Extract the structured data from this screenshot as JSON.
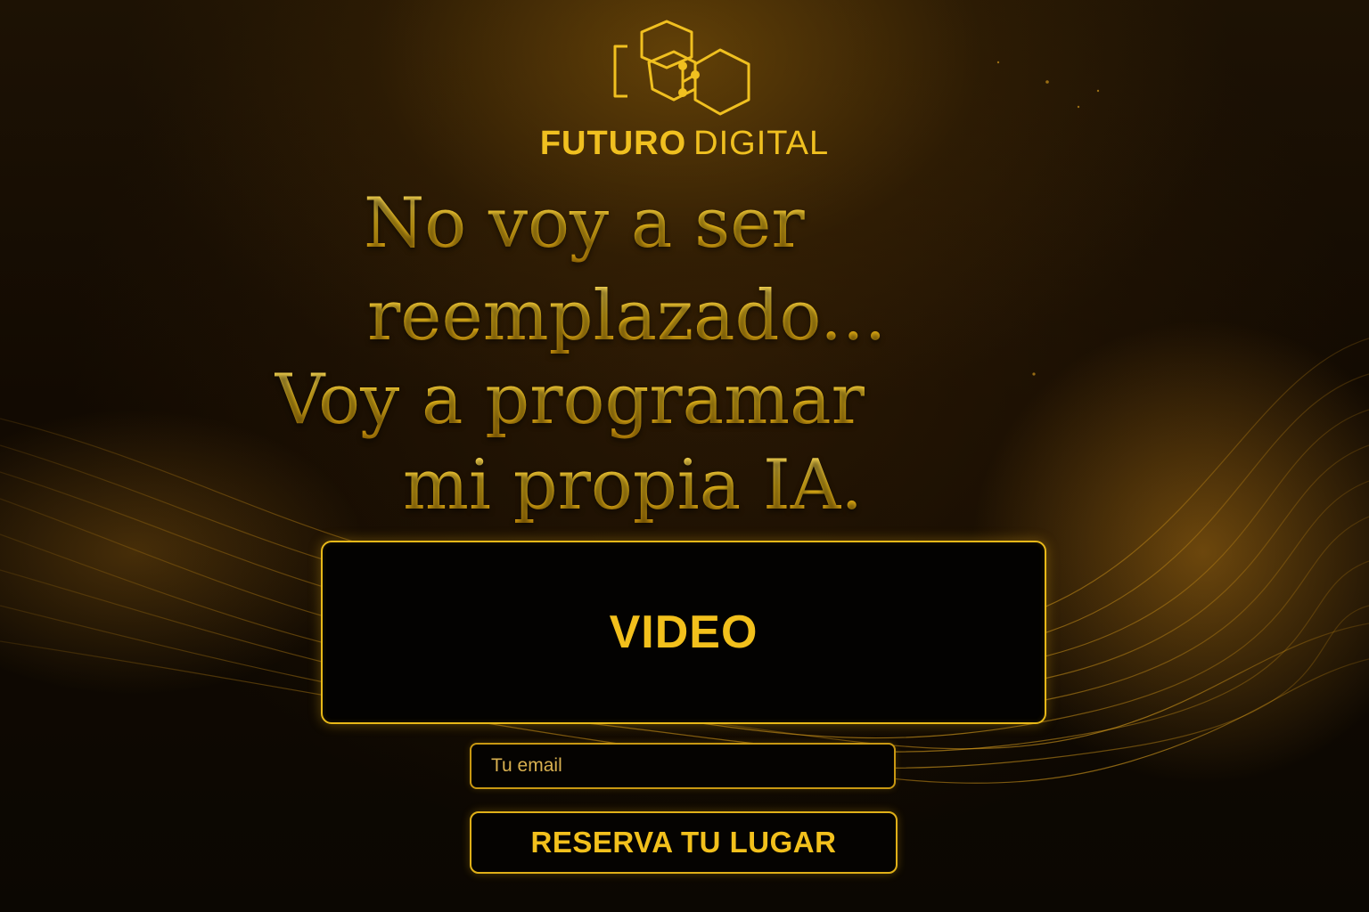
{
  "brand": {
    "name_bold": "FUTURO",
    "name_light": "DIGITAL",
    "logo_icon": "hexagon-network-logo-icon",
    "accent_color": "#f2c01c"
  },
  "hero": {
    "headline_lines": [
      "No voy a ser",
      "reemplazado...",
      "Voy a programar",
      "mi propia IA."
    ]
  },
  "video": {
    "label": "VIDEO"
  },
  "form": {
    "email_placeholder": "Tu email",
    "submit_label": "RESERVA TU LUGAR"
  }
}
